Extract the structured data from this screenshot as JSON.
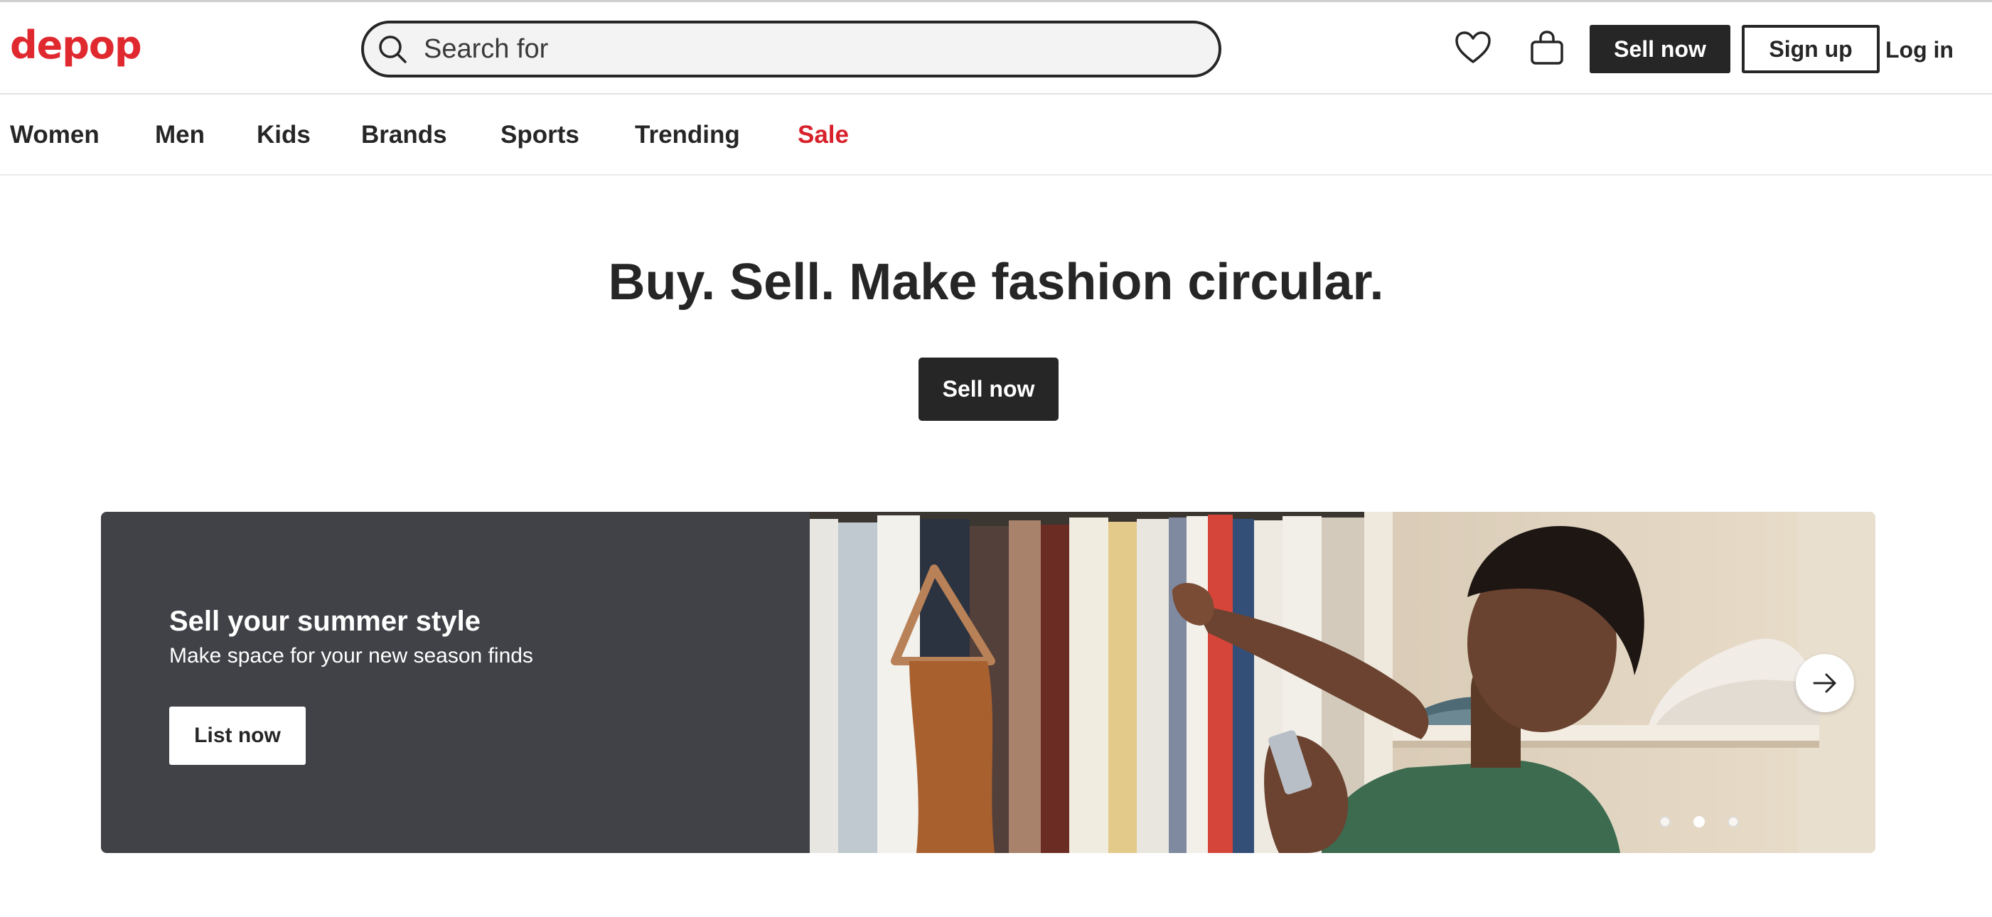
{
  "header": {
    "logo": "depop",
    "search_placeholder": "Search for",
    "sell_now_label": "Sell now",
    "sign_up_label": "Sign up",
    "log_in_label": "Log in",
    "icons": [
      "search-icon",
      "heart-icon",
      "shopping-bag-icon"
    ]
  },
  "nav": {
    "items": [
      {
        "label": "Women"
      },
      {
        "label": "Men"
      },
      {
        "label": "Kids"
      },
      {
        "label": "Brands"
      },
      {
        "label": "Sports"
      },
      {
        "label": "Trending"
      },
      {
        "label": "Sale",
        "highlight": true
      }
    ]
  },
  "hero": {
    "title": "Buy. Sell. Make fashion circular.",
    "cta_label": "Sell now"
  },
  "banner": {
    "title": "Sell your summer style",
    "subtitle": "Make space for your new season finds",
    "cta_label": "List now",
    "slide_count": 3,
    "active_slide": 2,
    "next_icon": "arrow-right-icon"
  },
  "colors": {
    "brand": "#e0282f",
    "sale": "#d8212b",
    "dark": "#262626",
    "banner_panel": "#404247"
  }
}
